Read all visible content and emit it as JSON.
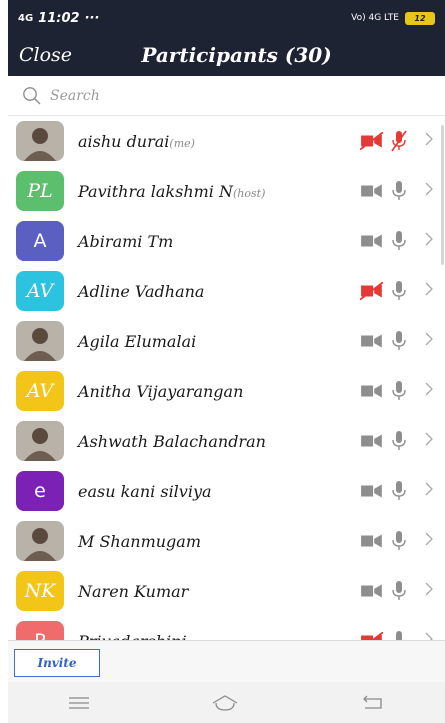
{
  "status_bar": {
    "signal": "4G",
    "time": "11:02",
    "extra": "···",
    "network": "Vo) 4G LTE",
    "battery": "12"
  },
  "header": {
    "close_label": "Close",
    "title": "Participants (30)"
  },
  "search": {
    "placeholder": "Search"
  },
  "participants": [
    {
      "name": "aishu durai",
      "tag": "(me)",
      "avatar_text": "",
      "avatar_color": "#c9c3bb",
      "video_muted": true,
      "audio_muted": true
    },
    {
      "name": "Pavithra lakshmi N",
      "tag": "(host)",
      "avatar_text": "PL",
      "avatar_color": "#5cbf6e",
      "video_muted": false,
      "audio_muted": false
    },
    {
      "name": "Abirami Tm",
      "tag": "",
      "avatar_text": "A",
      "avatar_color": "#5a5fc2",
      "video_muted": false,
      "audio_muted": false
    },
    {
      "name": "Adline Vadhana",
      "tag": "",
      "avatar_text": "AV",
      "avatar_color": "#2cc3e0",
      "video_muted": true,
      "audio_muted": false
    },
    {
      "name": "Agila Elumalai",
      "tag": "",
      "avatar_text": "",
      "avatar_color": "#c9c3bb",
      "video_muted": false,
      "audio_muted": false
    },
    {
      "name": "Anitha Vijayarangan",
      "tag": "",
      "avatar_text": "AV",
      "avatar_color": "#f2c518",
      "video_muted": false,
      "audio_muted": false
    },
    {
      "name": "Ashwath Balachandran",
      "tag": "",
      "avatar_text": "",
      "avatar_color": "#c9c3bb",
      "video_muted": false,
      "audio_muted": false
    },
    {
      "name": "easu kani silviya",
      "tag": "",
      "avatar_text": "e",
      "avatar_color": "#7b21b6",
      "video_muted": false,
      "audio_muted": false
    },
    {
      "name": "M Shanmugam",
      "tag": "",
      "avatar_text": "",
      "avatar_color": "#c9c3bb",
      "video_muted": false,
      "audio_muted": false
    },
    {
      "name": "Naren Kumar",
      "tag": "",
      "avatar_text": "NK",
      "avatar_color": "#f2c518",
      "video_muted": false,
      "audio_muted": false
    },
    {
      "name": "Priyadarshini",
      "tag": "",
      "avatar_text": "P",
      "avatar_color": "#f06b6b",
      "video_muted": true,
      "audio_muted": false
    }
  ],
  "footer": {
    "invite_label": "Invite"
  },
  "colors": {
    "header_bg": "#1e2333",
    "muted_red": "#e53935",
    "icon_gray": "#8e8e8e"
  }
}
